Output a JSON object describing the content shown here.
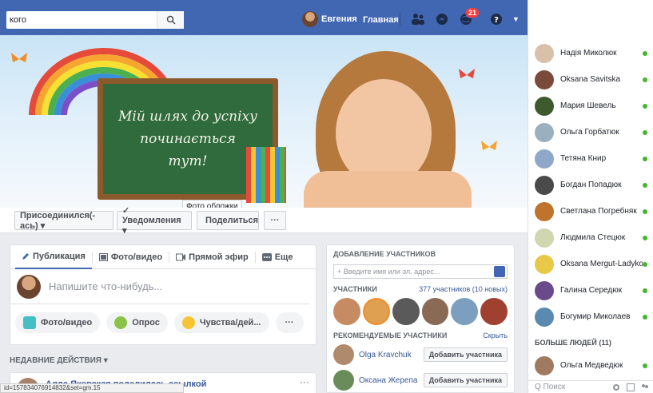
{
  "topbar": {
    "search_value": "кого",
    "user_name": "Евгения",
    "home_label": "Главная",
    "notif_count": "21",
    "color": "#4267b2"
  },
  "cover": {
    "board_lines": [
      "Мій шлях до успіху",
      "починається",
      "тут!"
    ],
    "tooltip": "Фото обложки"
  },
  "actions": {
    "joined": "Присоединился(-ась) ▾",
    "notifications": "✓ Уведомления ▾",
    "share": "Поделиться",
    "more": "···"
  },
  "composer": {
    "tabs": [
      "Публикация",
      "Фото/видео",
      "Прямой эфир",
      "Еще"
    ],
    "placeholder": "Напишите что-нибудь...",
    "pills": [
      "Фото/видео",
      "Опрос",
      "Чувства/дей...",
      "···"
    ]
  },
  "feed": {
    "recent_label": "НЕДАВНИЕ ДЕЙСТВИЯ ▾",
    "post_text": "Алла Яковская поделилась ссылкой",
    "more": "···",
    "status_url": "id=157834076914832&set=gm.15"
  },
  "members": {
    "add_title": "ДОБАВЛЕНИЕ УЧАСТНИКОВ",
    "add_placeholder": "+ Введите имя или эл. адрес...",
    "members_label": "УЧАСТНИКИ",
    "members_count": "377 участников (10 новых)",
    "recommended_label": "РЕКОМЕНДУЕМЫЕ УЧАСТНИКИ",
    "hide_label": "Скрыть",
    "suggestions": [
      {
        "name": "Olga Kravchuk",
        "button": "Добавить участника"
      },
      {
        "name": "Оксана Жерепа",
        "button": "Добавить участника"
      }
    ]
  },
  "chat": {
    "contacts": [
      "Надія Миколюк",
      "Oksana Savitska",
      "Мария Шевель",
      "Ольга Горбатюк",
      "Тетяна Книр",
      "Богдан Попадюк",
      "Светлана Погребняк",
      "Людмила Стецюк",
      "Oksana Mergut-Ladyko",
      "Галина Середюк",
      "Богумир Миколаев"
    ],
    "more_people": "БОЛЬШЕ ЛЮДЕЙ (11)",
    "extra_contact": "Ольга Медведюк",
    "search_placeholder": "Q Поиск"
  }
}
